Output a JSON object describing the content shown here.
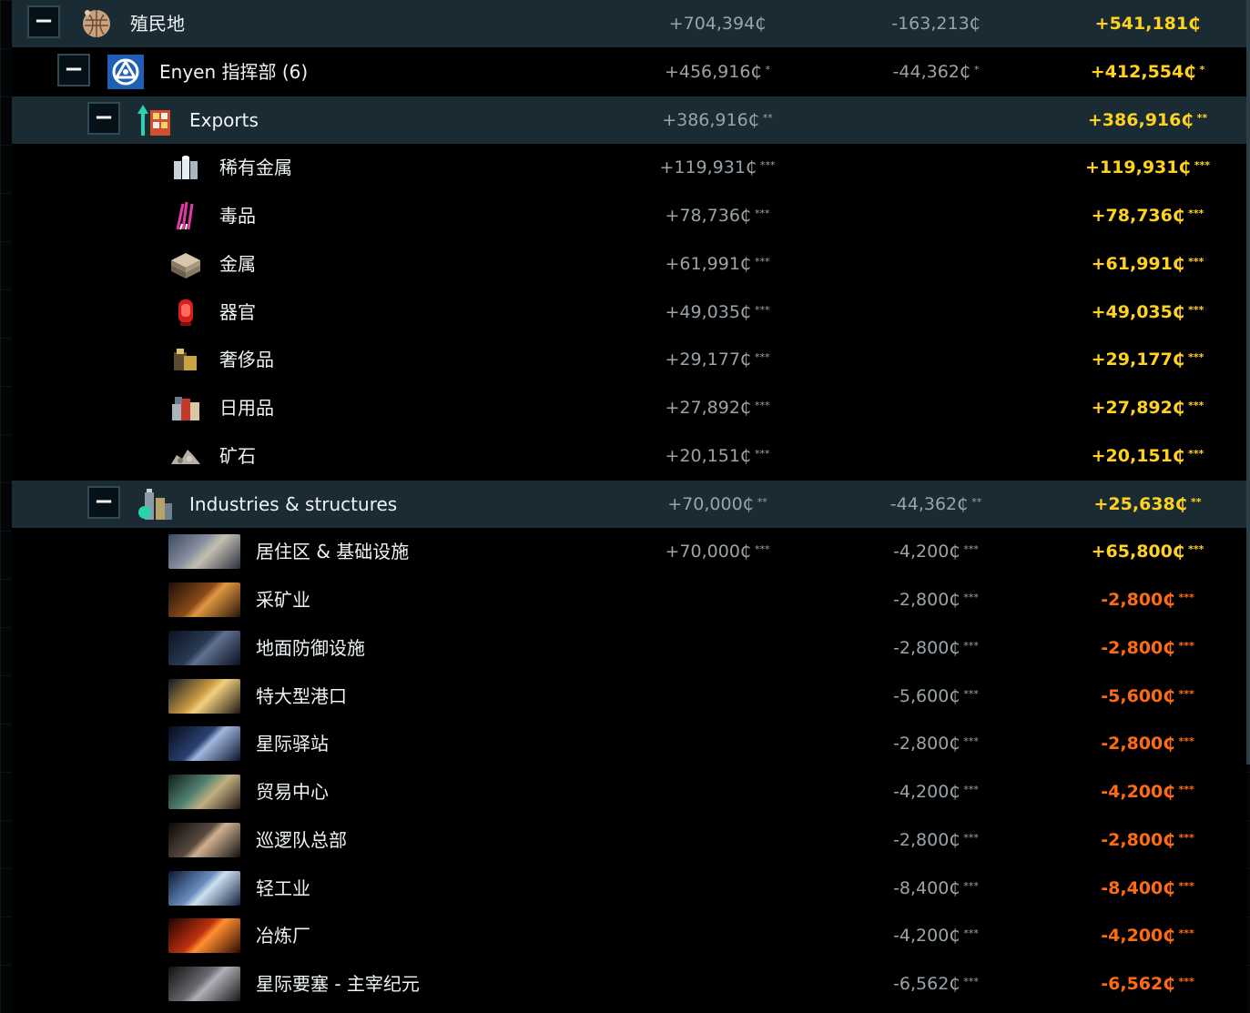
{
  "rows": [
    {
      "kind": "colony",
      "label": "殖民地",
      "income": "+704,394₵",
      "expense": "-163,213₵",
      "net": "+541,181₵",
      "stars": "",
      "net_sign": "pos"
    },
    {
      "kind": "system",
      "label": "Enyen 指挥部 (6)",
      "income": "+456,916₵",
      "expense": "-44,362₵",
      "net": "+412,554₵",
      "stars": "*",
      "net_sign": "pos"
    },
    {
      "kind": "group",
      "label": "Exports",
      "income": "+386,916₵",
      "expense": "",
      "net": "+386,916₵",
      "stars": "**",
      "net_sign": "pos"
    },
    {
      "kind": "export",
      "icon": "rare-metals-icon",
      "label": "稀有金属",
      "income": "+119,931₵",
      "expense": "",
      "net": "+119,931₵",
      "stars": "***",
      "net_sign": "pos"
    },
    {
      "kind": "export",
      "icon": "drugs-icon",
      "label": "毒品",
      "income": "+78,736₵",
      "expense": "",
      "net": "+78,736₵",
      "stars": "***",
      "net_sign": "pos"
    },
    {
      "kind": "export",
      "icon": "metals-icon",
      "label": "金属",
      "income": "+61,991₵",
      "expense": "",
      "net": "+61,991₵",
      "stars": "***",
      "net_sign": "pos"
    },
    {
      "kind": "export",
      "icon": "organs-icon",
      "label": "器官",
      "income": "+49,035₵",
      "expense": "",
      "net": "+49,035₵",
      "stars": "***",
      "net_sign": "pos"
    },
    {
      "kind": "export",
      "icon": "luxury-goods-icon",
      "label": "奢侈品",
      "income": "+29,177₵",
      "expense": "",
      "net": "+29,177₵",
      "stars": "***",
      "net_sign": "pos"
    },
    {
      "kind": "export",
      "icon": "domestic-goods-icon",
      "label": "日用品",
      "income": "+27,892₵",
      "expense": "",
      "net": "+27,892₵",
      "stars": "***",
      "net_sign": "pos"
    },
    {
      "kind": "export",
      "icon": "ore-icon",
      "label": "矿石",
      "income": "+20,151₵",
      "expense": "",
      "net": "+20,151₵",
      "stars": "***",
      "net_sign": "pos"
    },
    {
      "kind": "group",
      "label": "Industries & structures",
      "income": "+70,000₵",
      "expense": "-44,362₵",
      "net": "+25,638₵",
      "stars": "**",
      "net_sign": "pos"
    },
    {
      "kind": "industry",
      "thumb": "population-thumbnail",
      "label": "居住区 & 基础设施",
      "income": "+70,000₵",
      "expense": "-4,200₵",
      "net": "+65,800₵",
      "stars": "***",
      "net_sign": "pos"
    },
    {
      "kind": "industry",
      "thumb": "mining-thumbnail",
      "label": "采矿业",
      "income": "",
      "expense": "-2,800₵",
      "net": "-2,800₵",
      "stars": "***",
      "net_sign": "neg"
    },
    {
      "kind": "industry",
      "thumb": "ground-defense-thumbnail",
      "label": "地面防御设施",
      "income": "",
      "expense": "-2,800₵",
      "net": "-2,800₵",
      "stars": "***",
      "net_sign": "neg"
    },
    {
      "kind": "industry",
      "thumb": "megaport-thumbnail",
      "label": "特大型港口",
      "income": "",
      "expense": "-5,600₵",
      "net": "-5,600₵",
      "stars": "***",
      "net_sign": "neg"
    },
    {
      "kind": "industry",
      "thumb": "waystation-thumbnail",
      "label": "星际驿站",
      "income": "",
      "expense": "-2,800₵",
      "net": "-2,800₵",
      "stars": "***",
      "net_sign": "neg"
    },
    {
      "kind": "industry",
      "thumb": "commerce-thumbnail",
      "label": "贸易中心",
      "income": "",
      "expense": "-4,200₵",
      "net": "-4,200₵",
      "stars": "***",
      "net_sign": "neg"
    },
    {
      "kind": "industry",
      "thumb": "patrol-hq-thumbnail",
      "label": "巡逻队总部",
      "income": "",
      "expense": "-2,800₵",
      "net": "-2,800₵",
      "stars": "***",
      "net_sign": "neg"
    },
    {
      "kind": "industry",
      "thumb": "light-industry-thumbnail",
      "label": "轻工业",
      "income": "",
      "expense": "-8,400₵",
      "net": "-8,400₵",
      "stars": "***",
      "net_sign": "neg"
    },
    {
      "kind": "industry",
      "thumb": "refining-thumbnail",
      "label": "冶炼厂",
      "income": "",
      "expense": "-4,200₵",
      "net": "-4,200₵",
      "stars": "***",
      "net_sign": "neg"
    },
    {
      "kind": "industry",
      "thumb": "star-fortress-thumbnail",
      "label": "星际要塞 - 主宰纪元",
      "income": "",
      "expense": "-6,562₵",
      "net": "-6,562₵",
      "stars": "***",
      "net_sign": "neg"
    }
  ],
  "toggle_symbol": "−",
  "colors": {
    "positive": "#ffd21f",
    "negative": "#ff6b12",
    "muted": "#9aa3a8",
    "highlight": "#1a2b33"
  }
}
